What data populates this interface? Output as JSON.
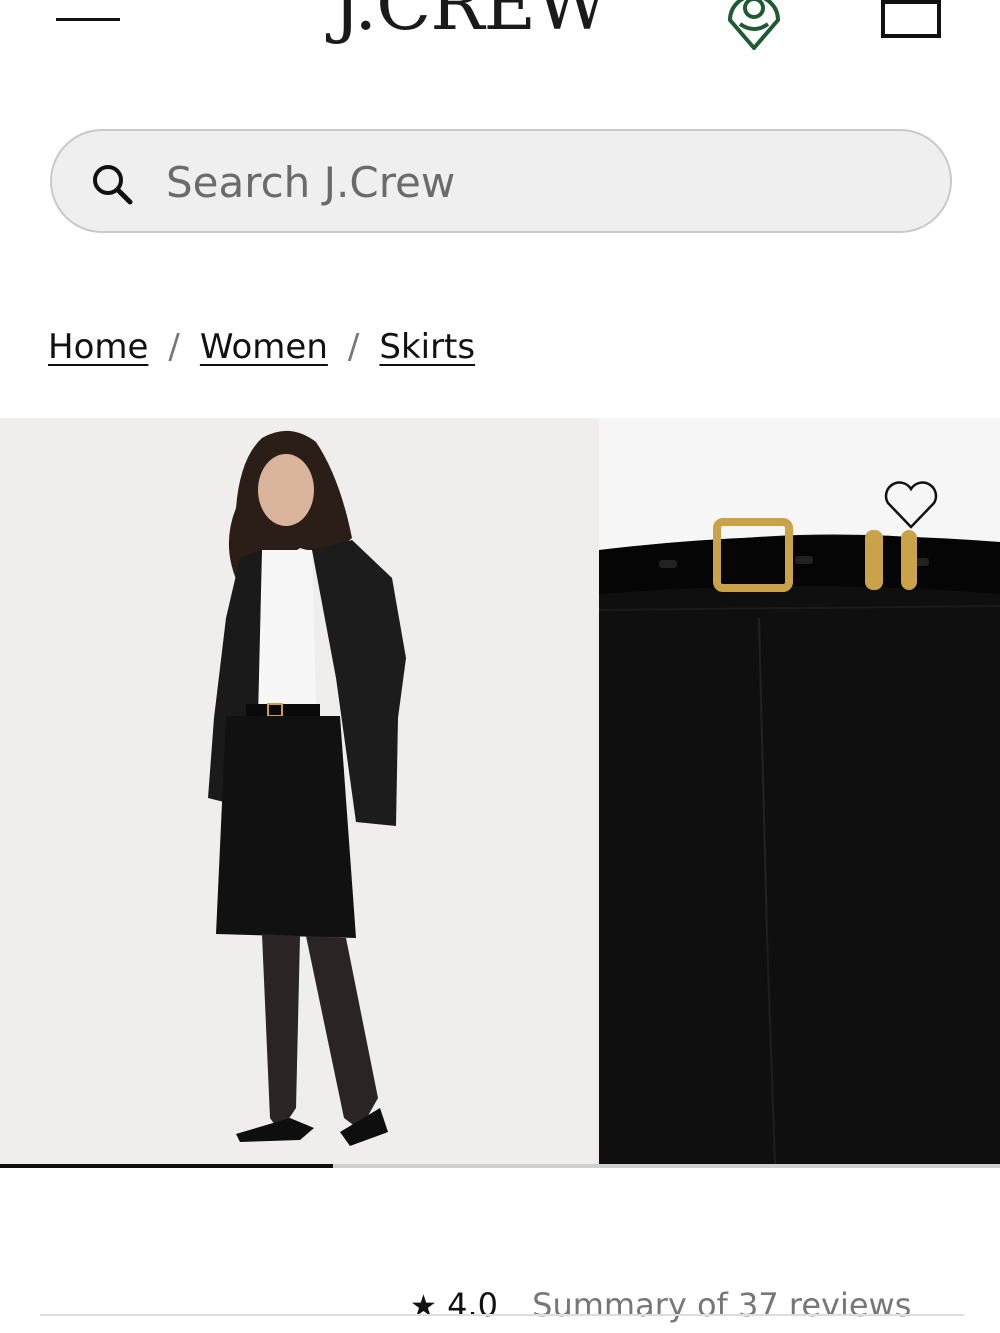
{
  "header": {
    "logo_text": "J.CREW",
    "menu_icon": "hamburger-menu-icon",
    "store_icon": "store-locator-icon",
    "bag_icon": "shopping-bag-icon"
  },
  "search": {
    "placeholder": "Search J.Crew",
    "icon": "search-icon"
  },
  "breadcrumb": {
    "items": [
      "Home",
      "Women",
      "Skirts"
    ],
    "separator": "/"
  },
  "gallery": {
    "slides": [
      "model-full-outfit",
      "skirt-waist-detail"
    ],
    "progress": 0.333,
    "wishlist_icon": "heart-icon"
  },
  "reviews": {
    "rating": "4.0",
    "summary": "Summary of 37 reviews",
    "star_icon": "star-icon"
  },
  "colors": {
    "text": "#111111",
    "search_bg": "#efefef",
    "store_icon_green": "#1f5a32",
    "progress_track": "#cfcfcf"
  }
}
